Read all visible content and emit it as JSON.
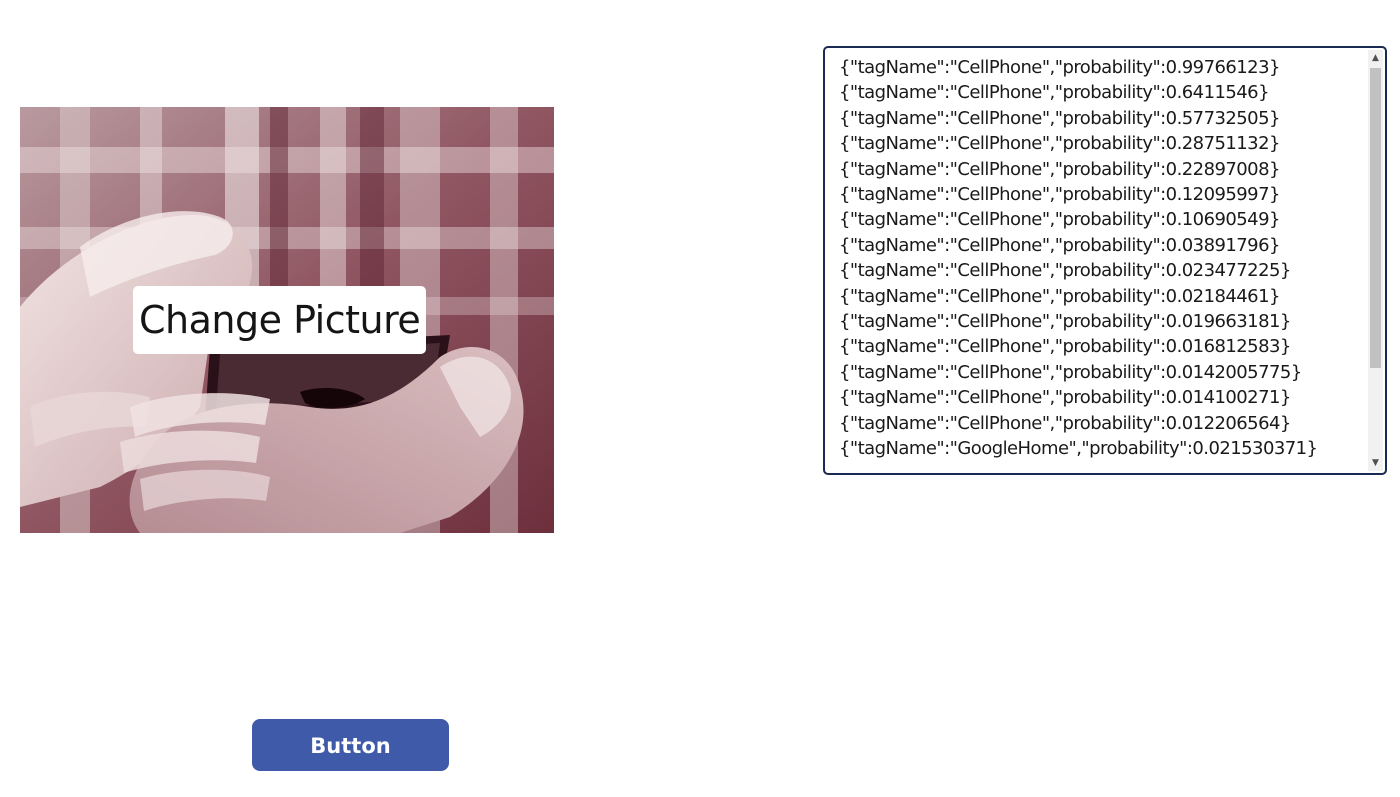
{
  "image_control": {
    "overlay_label": "Change Picture",
    "photo_icon": "photo-hands-holding-cellphone"
  },
  "results": {
    "lines": [
      "{\"tagName\":\"CellPhone\",\"probability\":0.99766123}",
      "{\"tagName\":\"CellPhone\",\"probability\":0.6411546}",
      "{\"tagName\":\"CellPhone\",\"probability\":0.57732505}",
      "{\"tagName\":\"CellPhone\",\"probability\":0.28751132}",
      "{\"tagName\":\"CellPhone\",\"probability\":0.22897008}",
      "{\"tagName\":\"CellPhone\",\"probability\":0.12095997}",
      "{\"tagName\":\"CellPhone\",\"probability\":0.10690549}",
      "{\"tagName\":\"CellPhone\",\"probability\":0.03891796}",
      "{\"tagName\":\"CellPhone\",\"probability\":0.023477225}",
      "{\"tagName\":\"CellPhone\",\"probability\":0.02184461}",
      "{\"tagName\":\"CellPhone\",\"probability\":0.019663181}",
      "{\"tagName\":\"CellPhone\",\"probability\":0.016812583}",
      "{\"tagName\":\"CellPhone\",\"probability\":0.0142005775}",
      "{\"tagName\":\"CellPhone\",\"probability\":0.014100271}",
      "{\"tagName\":\"CellPhone\",\"probability\":0.012206564}",
      "{\"tagName\":\"GoogleHome\",\"probability\":0.021530371}"
    ]
  },
  "button": {
    "label": "Button"
  },
  "colors": {
    "button_bg": "#3e5aa8",
    "textbox_border": "#1b2a52",
    "photo_tint": "#7a3f4a"
  }
}
